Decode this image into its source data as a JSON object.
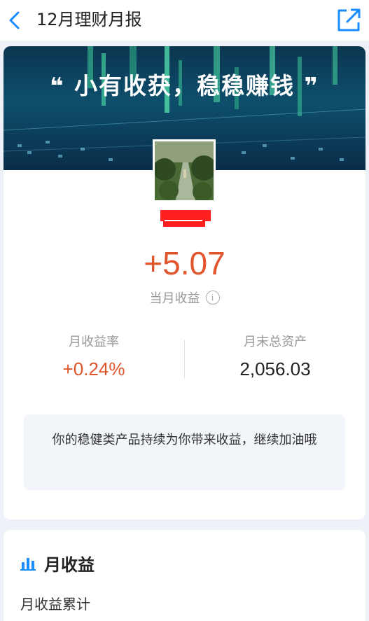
{
  "header": {
    "title": "12月理财月报",
    "back_icon": "chevron-left-icon",
    "share_icon": "share-external-icon"
  },
  "banner": {
    "slogan_open": "❝",
    "slogan": "小有收获，稳稳赚钱",
    "slogan_close": "❞"
  },
  "summary": {
    "amount": "+5.07",
    "amount_label": "当月收益",
    "info_icon_glyph": "i",
    "rate_label": "月收益率",
    "rate_value": "+0.24%",
    "assets_label": "月末总资产",
    "assets_value": "2,056.03",
    "tip": "你的稳健类产品持续为你带来收益，继续加油哦"
  },
  "section": {
    "title": "月收益",
    "subtitle": "月收益累计"
  },
  "colors": {
    "accent_blue": "#1a8cff",
    "profit_red": "#e0552c",
    "redact_red": "#ff1f1f"
  }
}
